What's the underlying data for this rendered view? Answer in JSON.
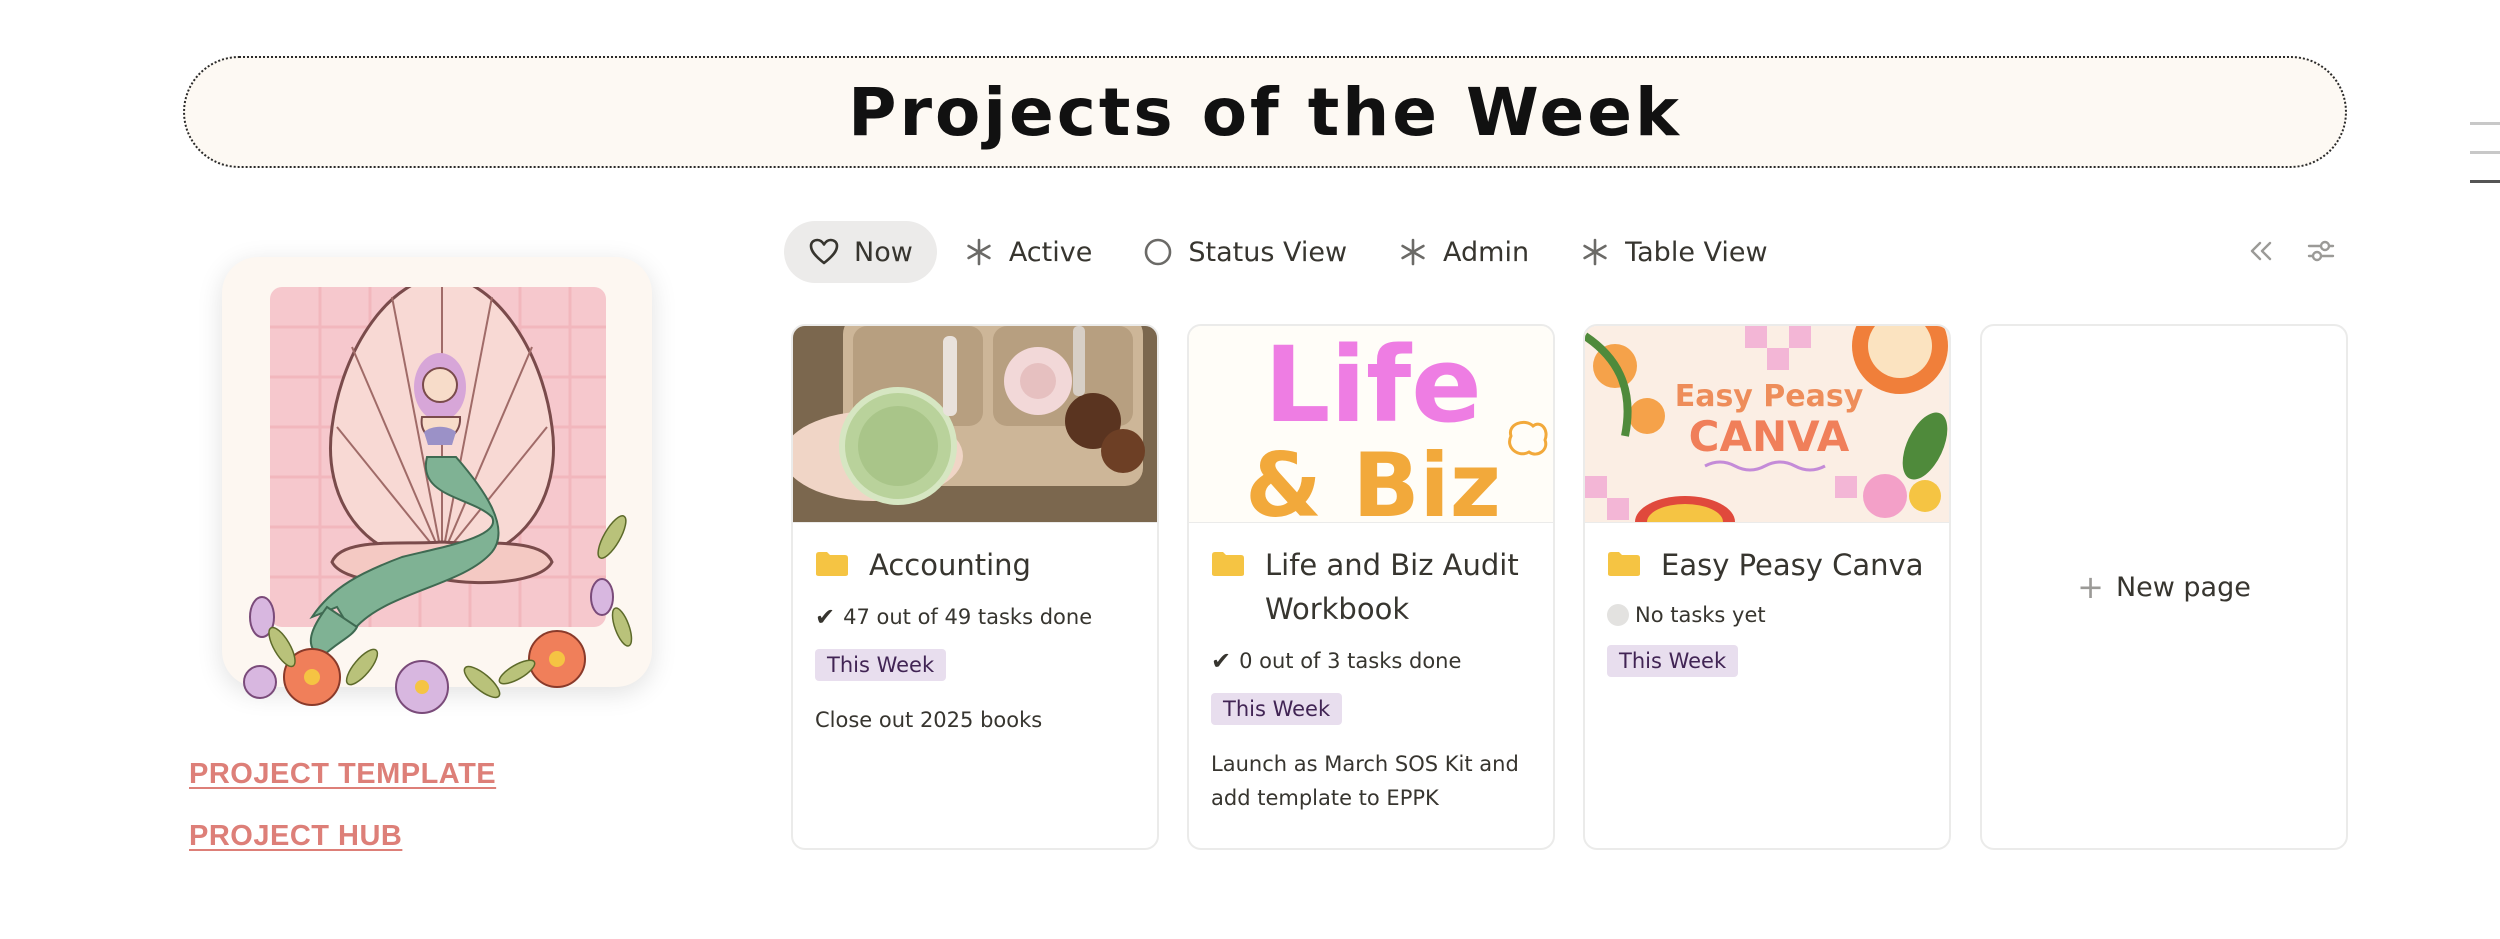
{
  "banner": {
    "title": "Projects of the Week"
  },
  "left_links": [
    "PROJECT TEMPLATE",
    "PROJECT HUB"
  ],
  "tabs": [
    {
      "label": "Now",
      "icon": "heart-icon",
      "active": true
    },
    {
      "label": "Active",
      "icon": "asterisk-icon"
    },
    {
      "label": "Status View",
      "icon": "circle-icon"
    },
    {
      "label": "Admin",
      "icon": "asterisk-icon"
    },
    {
      "label": "Table View",
      "icon": "asterisk-icon"
    }
  ],
  "view_tools": [
    "collapse-icon",
    "filter-settings-icon"
  ],
  "cards": [
    {
      "title": "Accounting",
      "progress": "47 out of 49 tasks done",
      "tag": "This Week",
      "note": "Close out 2025 books",
      "cover": "photo-drinks-sunglasses"
    },
    {
      "title": "Life and Biz Audit Workbook",
      "progress": "0 out of 3 tasks done",
      "tag": "This Week",
      "note": "Launch as March SOS Kit and add template to EPPK",
      "cover_text": [
        "Life",
        "& Biz"
      ]
    },
    {
      "title": "Easy Peasy Canva",
      "progress": "No tasks yet",
      "tag": "This Week",
      "note": "",
      "cover_text": [
        "Easy Peasy",
        "CANVA"
      ]
    }
  ],
  "new_page": {
    "label": "New page"
  },
  "colors": {
    "accent_link": "#dd7f78",
    "tag_bg": "#e8deee",
    "folder": "#f5c443"
  }
}
